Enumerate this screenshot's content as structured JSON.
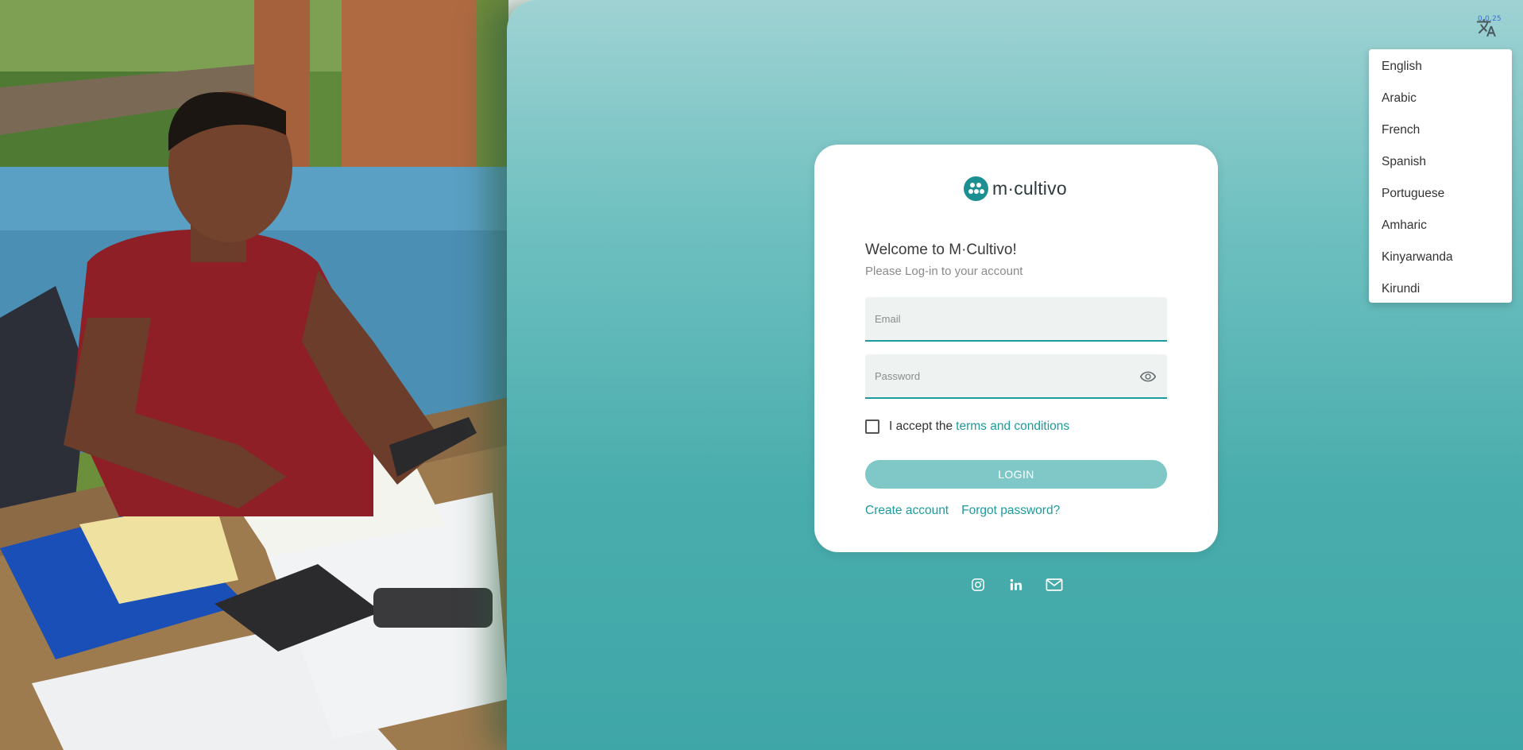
{
  "brand": {
    "logo_text": "m·cultivo",
    "accent_color": "#1f9a9b",
    "button_color": "#80c8c7"
  },
  "language_menu": {
    "version": "0.0.25",
    "icon": "translate-icon",
    "items": [
      {
        "label": "English"
      },
      {
        "label": "Arabic"
      },
      {
        "label": "French"
      },
      {
        "label": "Spanish"
      },
      {
        "label": "Portuguese"
      },
      {
        "label": "Amharic"
      },
      {
        "label": "Kinyarwanda"
      },
      {
        "label": "Kirundi"
      }
    ]
  },
  "login": {
    "title": "Welcome to M·Cultivo!",
    "subtitle": "Please Log-in to your account",
    "email_placeholder": "Email",
    "password_placeholder": "Password",
    "terms_prefix": "I accept the",
    "terms_link": "terms and conditions",
    "login_button": "LOGIN",
    "create_account": "Create account",
    "forgot_password": "Forgot password?"
  },
  "social": {
    "icons": [
      "instagram-icon",
      "linkedin-icon",
      "email-icon"
    ]
  }
}
